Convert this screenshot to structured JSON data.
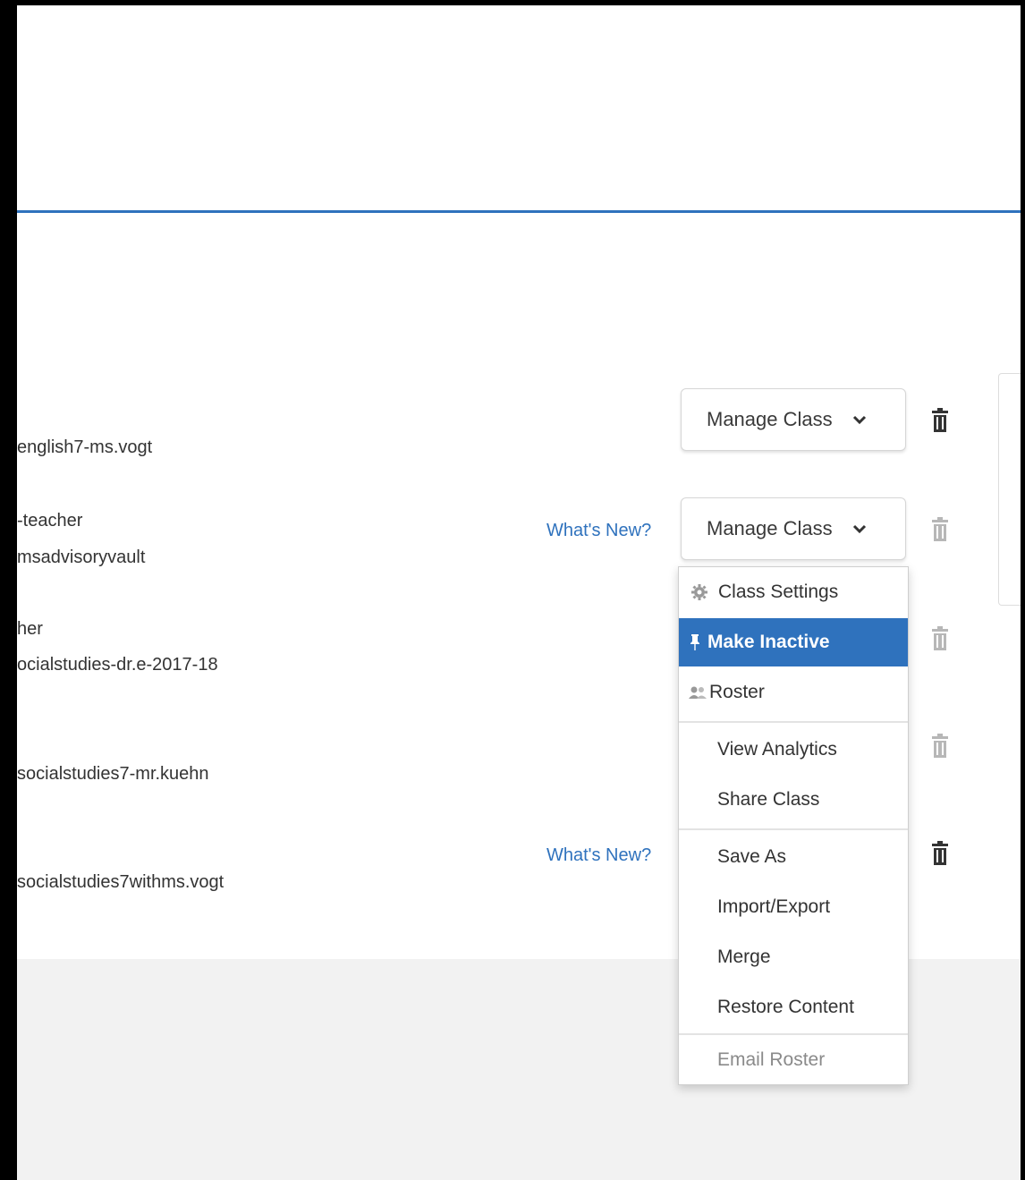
{
  "colors": {
    "accent": "#2f72bd",
    "menu_active_bg": "#2f72bd",
    "footer_bg": "#f2f2f2"
  },
  "rows": [
    {
      "line1": "",
      "line2": "english7-ms.vogt"
    },
    {
      "line1": "-teacher",
      "line2": "msadvisoryvault"
    },
    {
      "line1": "her",
      "line2": "ocialstudies-dr.e-2017-18"
    },
    {
      "line1": "",
      "line2": "socialstudies7-mr.kuehn"
    },
    {
      "line1": "",
      "line2": "socialstudies7withms.vogt"
    }
  ],
  "whats_new_label": "What's New?",
  "manage_button_label": "Manage Class",
  "icons": {
    "trash": "trash-icon",
    "chevron": "chevron-down-icon",
    "gear": "gear-icon",
    "pin": "pushpin-icon",
    "roster": "people-icon"
  },
  "menu": {
    "items": [
      {
        "label": "Class Settings",
        "icon": "gear-icon"
      },
      {
        "label": "Make Inactive",
        "icon": "pushpin-icon",
        "active": true
      },
      {
        "label": "Roster",
        "icon": "people-icon"
      },
      {
        "label": "View Analytics"
      },
      {
        "label": "Share Class"
      },
      {
        "label": "Save As"
      },
      {
        "label": "Import/Export"
      },
      {
        "label": "Merge"
      },
      {
        "label": "Restore Content"
      },
      {
        "label": "Email Roster",
        "disabled": true
      }
    ]
  }
}
